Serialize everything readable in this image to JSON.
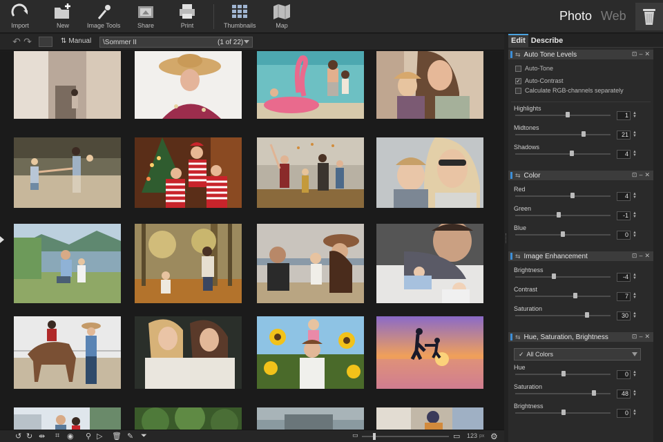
{
  "toolbar": {
    "import": "Import",
    "new": "New",
    "image_tools": "Image Tools",
    "share": "Share",
    "print": "Print",
    "thumbnails": "Thumbnails",
    "map": "Map"
  },
  "mode": {
    "photo": "Photo",
    "web": "Web"
  },
  "subbar": {
    "sort_label": "Manual",
    "path": "\\Sommer II",
    "count": "(1 of 22)"
  },
  "panel": {
    "tabs": {
      "edit": "Edit",
      "describe": "Describe"
    },
    "auto_tone": {
      "title": "Auto Tone Levels",
      "auto_tone": "Auto-Tone",
      "auto_contrast": "Auto-Contrast",
      "calc_rgb": "Calculate RGB-channels separately",
      "auto_tone_checked": false,
      "auto_contrast_checked": true,
      "calc_rgb_checked": false,
      "highlights_label": "Highlights",
      "highlights": "1",
      "midtones_label": "Midtones",
      "midtones": "21",
      "shadows_label": "Shadows",
      "shadows": "4"
    },
    "color": {
      "title": "Color",
      "red_label": "Red",
      "red": "4",
      "green_label": "Green",
      "green": "-1",
      "blue_label": "Blue",
      "blue": "0"
    },
    "enhancement": {
      "title": "Image Enhancement",
      "brightness_label": "Brightness",
      "brightness": "-4",
      "contrast_label": "Contrast",
      "contrast": "7",
      "saturation_label": "Saturation",
      "saturation": "30"
    },
    "hsb": {
      "title": "Hue, Saturation, Brightness",
      "channel": "All Colors",
      "hue_label": "Hue",
      "hue": "0",
      "saturation_label": "Saturation",
      "saturation": "48",
      "brightness_label": "Brightness",
      "brightness": "0"
    }
  },
  "bottombar": {
    "zoom_value": "123",
    "zoom_unit": "px"
  },
  "colors": {
    "accent": "#3d8fd8",
    "background": "#1b1b1b",
    "panel": "#2a2a2a"
  }
}
